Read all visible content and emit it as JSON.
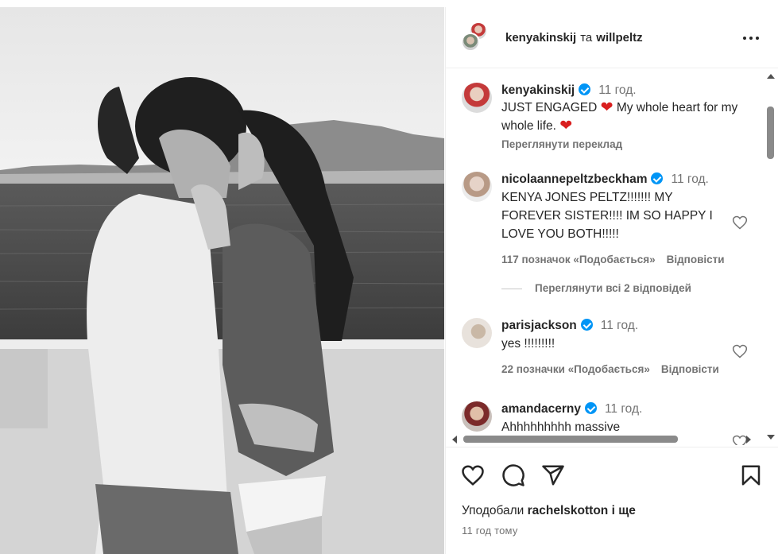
{
  "header": {
    "user1": "kenyakinskij",
    "conjunction": "та",
    "user2": "willpeltz"
  },
  "comments": [
    {
      "user": "kenyakinskij",
      "time": "11 год.",
      "text_part1": "JUST ENGAGED ",
      "text_part2": " My whole heart for my whole life. ",
      "translate_label": "Переглянути переклад"
    },
    {
      "user": "nicolaannepeltzbeckham",
      "time": "11 год.",
      "text": "KENYA JONES PELTZ!!!!!!! MY FOREVER SISTER!!!! IM SO HAPPY I LOVE YOU BOTH!!!!!",
      "likes": "117 позначок «Подобається»",
      "reply": "Відповісти"
    },
    {
      "user": "parisjackson",
      "time": "11 год.",
      "text": "yes !!!!!!!!!",
      "likes": "22 позначки «Подобається»",
      "reply": "Відповісти"
    },
    {
      "user": "amandacerny",
      "time": "11 год.",
      "text": "Ahhhhhhhhh massive"
    }
  ],
  "view_replies": "Переглянути всі 2 відповідей",
  "heart_glyph": "❤",
  "likes_line": {
    "prefix": "Уподобали ",
    "user": "rachelskotton",
    "suffix": " і ще"
  },
  "post_time": "11 год тому",
  "icons": [
    "more-icon",
    "heart-icon",
    "comment-icon",
    "share-icon",
    "bookmark-icon",
    "verified-badge-icon"
  ],
  "colors": {
    "verified": "#0095f6",
    "heart": "#d91f1f",
    "secondary_text": "#737373"
  }
}
